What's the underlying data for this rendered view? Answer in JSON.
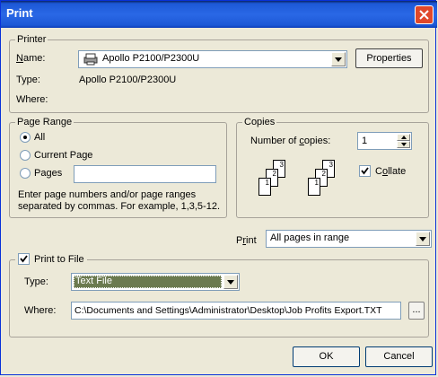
{
  "window": {
    "title": "Print"
  },
  "printer": {
    "group_label": "Printer",
    "name_label": "Name:",
    "name_value": "Apollo P2100/P2300U",
    "properties_label": "Properties",
    "type_label": "Type:",
    "type_value": "Apollo P2100/P2300U",
    "where_label": "Where:"
  },
  "page_range": {
    "group_label": "Page Range",
    "options": [
      {
        "label": "All",
        "selected": true
      },
      {
        "label": "Current Page",
        "selected": false
      },
      {
        "label": "Pages",
        "selected": false
      }
    ],
    "pages_value": "",
    "hint": "Enter page numbers and/or page ranges separated by commas.  For example, 1,3,5-12."
  },
  "copies": {
    "group_label": "Copies",
    "number_label": "Number of copies:",
    "number_value": "1",
    "collate_label": "Collate",
    "collate_checked": true,
    "stack_pages": [
      "1",
      "2",
      "3"
    ]
  },
  "print_what": {
    "label": "Print",
    "value": "All pages in range"
  },
  "print_to_file": {
    "label": "Print to File",
    "checked": true,
    "type_label": "Type:",
    "type_value": "Text File",
    "where_label": "Where:",
    "where_value": "C:\\Documents and Settings\\Administrator\\Desktop\\Job Profits Export.TXT",
    "browse_label": "..."
  },
  "buttons": {
    "ok": "OK",
    "cancel": "Cancel"
  },
  "colors": {
    "titlebar": "#1c58d6",
    "face": "#ece9d8",
    "selection": "#6b7a4f"
  }
}
